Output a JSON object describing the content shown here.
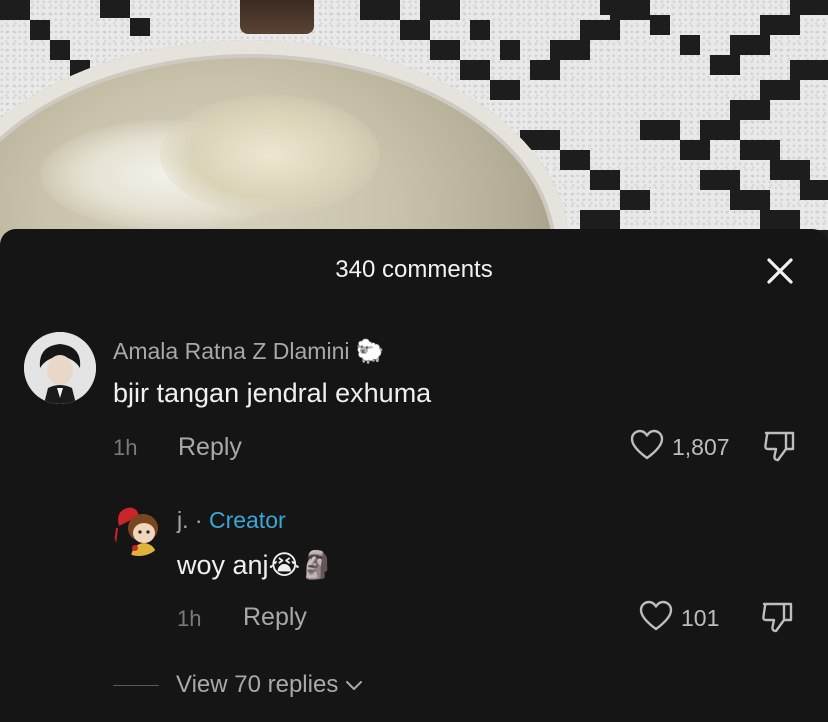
{
  "sheet": {
    "title": "340 comments",
    "close_icon": "close-icon"
  },
  "comments": [
    {
      "username": "Amala Ratna Z Dlamini",
      "badge_emoji": "🐑",
      "text": "bjir tangan jendral exhuma",
      "time": "1h",
      "reply_label": "Reply",
      "likes": "1,807"
    }
  ],
  "replies": [
    {
      "username": "j.",
      "separator": "·",
      "role": "Creator",
      "text": "woy anj",
      "emojis": "😭🗿",
      "time": "1h",
      "reply_label": "Reply",
      "likes": "101"
    }
  ],
  "view_replies_label": "View 70 replies",
  "colors": {
    "sheet_bg": "#151515",
    "creator": "#3aa6d6",
    "text": "#f0f0f0",
    "muted": "#a8a8a8"
  }
}
